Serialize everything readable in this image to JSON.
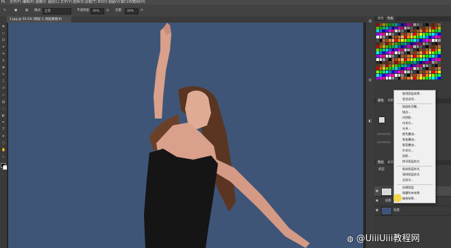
{
  "menubar": {
    "items": [
      "文件(F)",
      "编辑(E)",
      "图像(I)",
      "图层(L)",
      "文字(Y)",
      "选择(S)",
      "滤镜(T)",
      "3D(D)",
      "视图(V)",
      "窗口(W)",
      "帮助(H)"
    ]
  },
  "options": {
    "mode_label": "模式:",
    "mode_value": "正常",
    "opacity_label": "不透明度:",
    "opacity_value": "30%",
    "flow_label": "流量:",
    "flow_value": "30%"
  },
  "document": {
    "tab_title": "1.jpg @ 50.4% (图层 3, 图层蒙版/8)"
  },
  "panels": {
    "top_tabs": [
      "颜色",
      "色板"
    ],
    "mid_tabs": [
      "属性",
      "调整"
    ],
    "layers_tabs": [
      "图层",
      "通道",
      "路径"
    ],
    "layer_kind_label": "类型",
    "layer_rows": [
      {
        "name": "图层 3"
      },
      {
        "name": "投影"
      },
      {
        "name": "背景"
      }
    ]
  },
  "context_menu": {
    "items": [
      "使用图层效果...",
      "混合选项...",
      "斜面和浮雕...",
      "描边...",
      "内阴影...",
      "内发光...",
      "光泽...",
      "颜色叠加...",
      "渐变叠加...",
      "图案叠加...",
      "外发光...",
      "投影...",
      "拷贝图层样式",
      "粘贴图层样式",
      "清除图层样式",
      "全局光...",
      "创建图层",
      "隐藏所有效果",
      "缩放效果..."
    ]
  },
  "watermark": {
    "text": "@UiiiUiii教程网"
  },
  "colors": {
    "canvas_bg": "#3f5578",
    "ui_dark": "#3a3a3a",
    "menu_bg": "#f0f0f0",
    "cursor_highlight": "#f3d23a"
  },
  "icons": [
    "move-icon",
    "marquee-icon",
    "lasso-icon",
    "brush-icon",
    "eraser-icon",
    "eye-icon",
    "link-icon",
    "fx-icon"
  ]
}
